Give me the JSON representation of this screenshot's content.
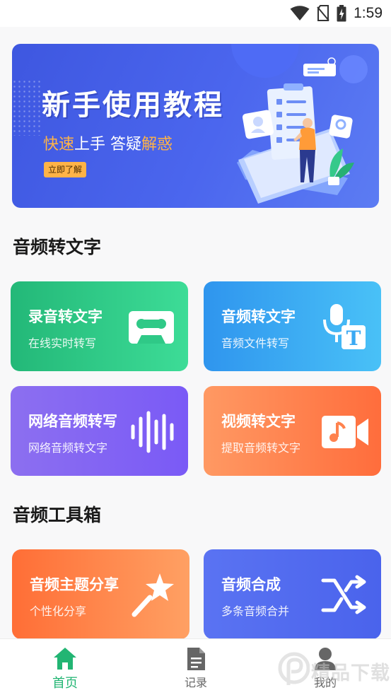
{
  "status_bar": {
    "time": "1:59"
  },
  "banner": {
    "title": "新手使用教程",
    "subtitle_part1": "快速",
    "subtitle_part2": "上手  答疑",
    "subtitle_part3": "解惑",
    "cta_label": "立即了解"
  },
  "sections": [
    {
      "title": "音频转文字",
      "cards": [
        {
          "title": "录音转文字",
          "subtitle": "在线实时转写",
          "icon": "cassette-icon",
          "color": "#2fc987"
        },
        {
          "title": "音频转文字",
          "subtitle": "音频文件转写",
          "icon": "mic-text-icon",
          "color": "#3aa9f3"
        },
        {
          "title": "网络音频转写",
          "subtitle": "网络音频转文字",
          "icon": "soundwave-icon",
          "color": "#8466f3"
        },
        {
          "title": "视频转文字",
          "subtitle": "提取音频转文字",
          "icon": "video-music-icon",
          "color": "#ff824e"
        }
      ]
    },
    {
      "title": "音频工具箱",
      "cards": [
        {
          "title": "音频主题分享",
          "subtitle": "个性化分享",
          "icon": "magic-wand-icon",
          "color": "#ff8245"
        },
        {
          "title": "音频合成",
          "subtitle": "多条音频合并",
          "icon": "merge-arrows-icon",
          "color": "#526bef"
        }
      ]
    }
  ],
  "tab_bar": {
    "tabs": [
      {
        "label": "首页",
        "icon": "home-icon",
        "active": true
      },
      {
        "label": "记录",
        "icon": "document-icon",
        "active": false
      },
      {
        "label": "我的",
        "icon": "user-icon",
        "active": false
      }
    ],
    "active_color": "#22b573"
  },
  "watermark": {
    "text": "精品下载"
  }
}
